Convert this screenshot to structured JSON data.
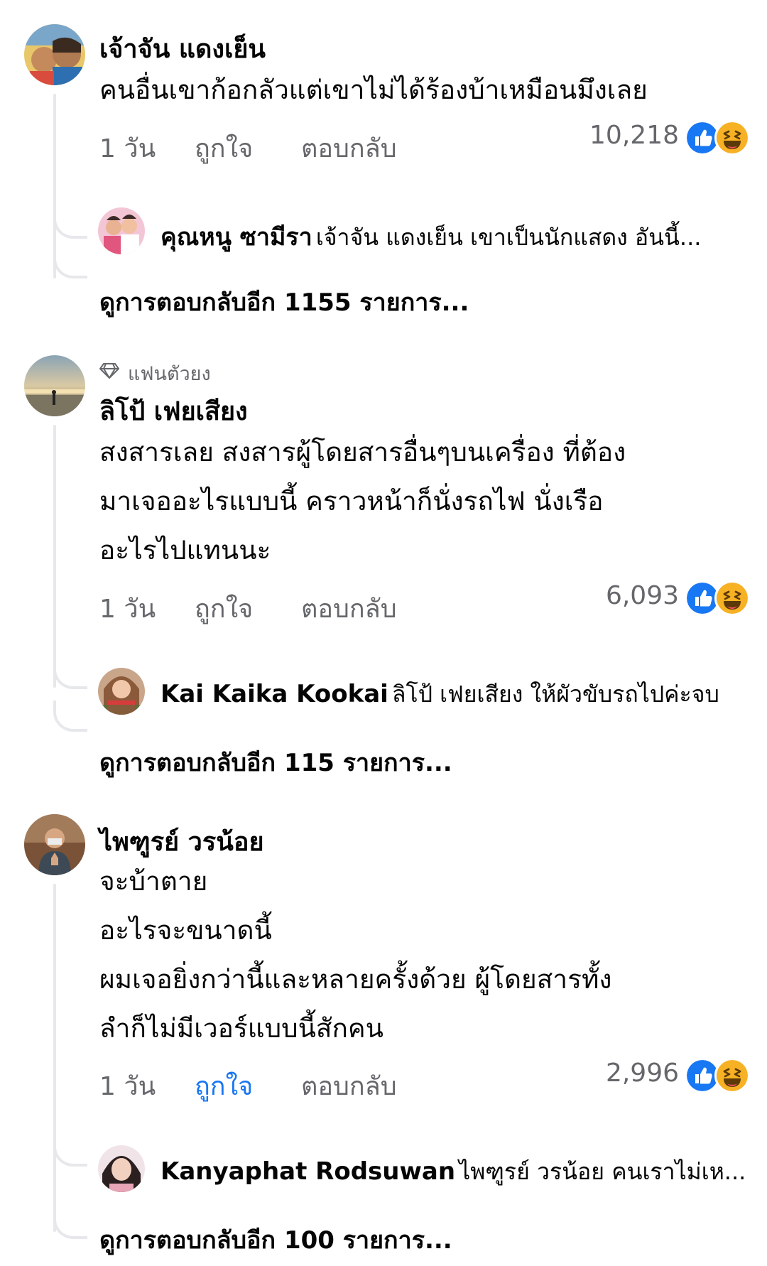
{
  "comments": [
    {
      "author": "เจ้าจัน แดงเย็น",
      "text_lines": [
        "คนอื่นเขาก้อกลัวแต่เขาไม่ได้ร้องบ้าเหมือนมึงเลย"
      ],
      "time": "1 วัน",
      "like_label": "ถูกใจ",
      "reply_label": "ตอบกลับ",
      "liked": false,
      "reaction_count": "10,218",
      "reactions": [
        "like-icon",
        "haha-icon"
      ],
      "reply": {
        "author": "คุณหนู ซามีรา",
        "text": "เจ้าจัน แดงเย็น เขาเป็นนักแสดง อันนี้..."
      },
      "more_replies": "ดูการตอบกลับอีก 1155 รายการ..."
    },
    {
      "badge_icon": "diamond-icon",
      "badge": "แฟนตัวยง",
      "author": "ลิโป้ เฟยเสียง",
      "text_lines": [
        "สงสารเลย สงสารผู้โดยสารอื่นๆบนเครื่อง ที่ต้อง",
        "มาเจออะไรแบบนี้ คราวหน้าก็นั่งรถไฟ นั่งเรือ",
        "อะไรไปแทนนะ"
      ],
      "time": "1 วัน",
      "like_label": "ถูกใจ",
      "reply_label": "ตอบกลับ",
      "liked": false,
      "reaction_count": "6,093",
      "reactions": [
        "like-icon",
        "haha-icon"
      ],
      "reply": {
        "author": "Kai Kaika Kookai",
        "text": "ลิโป้ เฟยเสียง ให้ผัวขับรถไปค่ะจบ"
      },
      "more_replies": "ดูการตอบกลับอีก 115 รายการ..."
    },
    {
      "author": "ไพฑูรย์ วรน้อย",
      "text_lines": [
        "จะบ้าตาย",
        "อะไรจะขนาดนี้",
        "ผมเจอยิ่งกว่านี้และหลายครั้งด้วย ผู้โดยสารทั้ง",
        "ลำก็ไม่มีเวอร์แบบนี้สักคน"
      ],
      "time": "1 วัน",
      "like_label": "ถูกใจ",
      "reply_label": "ตอบกลับ",
      "liked": true,
      "reaction_count": "2,996",
      "reactions": [
        "like-icon",
        "haha-icon"
      ],
      "reply": {
        "author": "Kanyaphat Rodsuwan",
        "text": "ไพฑูรย์ วรน้อย คนเราไม่เห..."
      },
      "more_replies": "ดูการตอบกลับอีก 100 รายการ..."
    }
  ],
  "colors": {
    "text": "#050505",
    "secondary": "#65676b",
    "link_blue": "#1877f2",
    "thread_line": "#e6e8ec",
    "haha_yellow": "#f7b125"
  }
}
